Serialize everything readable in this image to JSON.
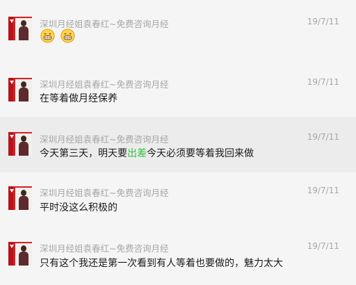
{
  "messages": [
    {
      "sender": "深圳月经姐袁春红~免费咨询月经",
      "time": "19/7/11",
      "emojis": [
        "grin-emoji",
        "grin-emoji"
      ]
    },
    {
      "sender": "深圳月经姐袁春红~免费咨询月经",
      "time": "19/7/11",
      "text": "在等着做月经保养"
    },
    {
      "sender": "深圳月经姐袁春红~免费咨询月经",
      "time": "19/7/11",
      "text_parts": [
        "今天第三天，明天要",
        "出差",
        "今天必须要等着我回来做"
      ],
      "highlight_color": "#34c03a"
    },
    {
      "sender": "深圳月经姐袁春红~免费咨询月经",
      "time": "19/7/11",
      "text": "平时没这么积极的"
    },
    {
      "sender": "深圳月经姐袁春红~免费咨询月经",
      "time": "19/7/11",
      "text": "只有这个我还是第一次看到有人等着也要做的，魅力太大"
    }
  ]
}
